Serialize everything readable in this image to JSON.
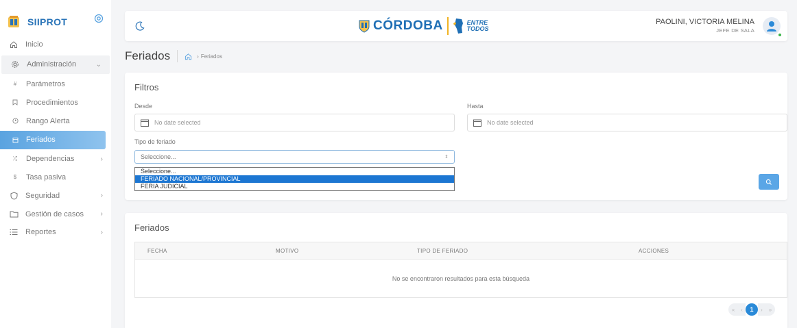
{
  "sidebar": {
    "brand": "SIIPROT",
    "items": [
      {
        "label": "Inicio",
        "icon": "home-icon"
      },
      {
        "label": "Administración",
        "icon": "gear-icon",
        "chevron": "⌄"
      },
      {
        "label": "Parámetros",
        "icon": "hash-icon"
      },
      {
        "label": "Procedimientos",
        "icon": "bookmark-icon"
      },
      {
        "label": "Rango Alerta",
        "icon": "clock-icon"
      },
      {
        "label": "Feriados",
        "icon": "calendar-icon"
      },
      {
        "label": "Dependencias",
        "icon": "shuffle-icon",
        "chevron": "›"
      },
      {
        "label": "Tasa pasiva",
        "icon": "dollar-icon"
      },
      {
        "label": "Seguridad",
        "icon": "shield-icon",
        "chevron": "›"
      },
      {
        "label": "Gestión de casos",
        "icon": "folder-icon",
        "chevron": "›"
      },
      {
        "label": "Reportes",
        "icon": "list-icon",
        "chevron": "›"
      }
    ]
  },
  "header": {
    "gov_name": "CÓRDOBA",
    "gov_slogan_1": "ENTRE",
    "gov_slogan_2": "TODOS",
    "user_name": "PAOLINI, VICTORIA MELINA",
    "user_role": "JEFE DE SALA"
  },
  "page": {
    "title": "Feriados",
    "breadcrumb_sep": "›",
    "breadcrumb": "Feriados"
  },
  "filters": {
    "title": "Filtros",
    "desde_label": "Desde",
    "desde_placeholder": "No date selected",
    "hasta_label": "Hasta",
    "hasta_placeholder": "No date selected",
    "tipo_label": "Tipo de feriado",
    "tipo_value": "Seleccione...",
    "tipo_caret": "⇕",
    "options": [
      "Seleccione...",
      "FERIADO NACIONAL/PROVINCIAL",
      "FERIA JUDICIAL"
    ],
    "search_icon": "search-icon"
  },
  "results": {
    "title": "Feriados",
    "columns": [
      "FECHA",
      "MOTIVO",
      "TIPO DE FERIADO",
      "ACCIONES"
    ],
    "empty_message": "No se encontraron resultados para esta búsqueda",
    "pagination": {
      "first": "«",
      "prev": "‹",
      "current": "1",
      "next": "›",
      "last": "»"
    }
  },
  "colors": {
    "primary": "#2a74b8",
    "active_nav": "#5aa3e0",
    "button": "#5aa6e6",
    "selected_option": "#1c76d2"
  }
}
